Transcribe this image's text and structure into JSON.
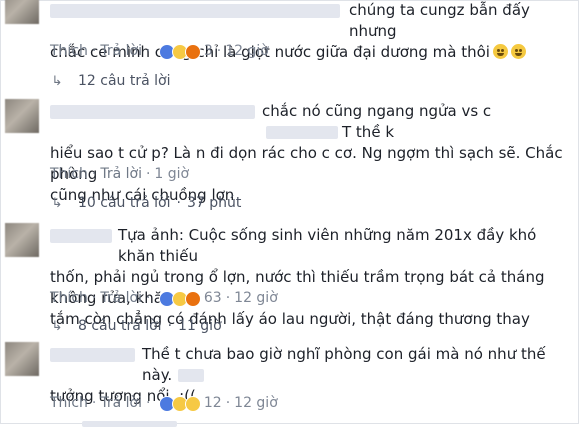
{
  "comments": [
    {
      "lines": [
        "chúng ta cungz bẫn đấy nhưng",
        "chắc ce mình cũng chỉ là giọt nước giữa đại dương mà thôi"
      ],
      "emoji": [
        "grinning-sweat",
        "grinning-sweat"
      ],
      "actions": {
        "like": "Thích",
        "reply": "Trả lời",
        "reaction_count": "3",
        "time": "12 giờ"
      },
      "reactions": [
        "like",
        "haha",
        "angry"
      ],
      "replies": "12 câu trả lời"
    },
    {
      "lines": [
        "chắc nó cũng ngang ngửa vs c",
        "T thề k",
        "hiểu sao t cử p? Là n đi dọn rác cho c cơ. Ng ngợm thì sạch sẽ. Chắc phòng",
        "cũng như cái chuồng lợn"
      ],
      "actions": {
        "like": "Thích",
        "reply": "Trả lời",
        "time": "1 giờ"
      },
      "replies": "10 câu trả lời",
      "replies_time": "37 phút"
    },
    {
      "lines": [
        "Tựa ảnh: Cuộc sống sinh viên những năm 201x đầy khó khăn thiếu",
        "thốn, phải ngủ trong ổ lợn, nước thì thiếu trầm trọng bát cả tháng không rửa, khăn",
        "tắm còn chẳng có đánh lấy áo lau người, thật đáng thương thay"
      ],
      "actions": {
        "like": "Thích",
        "reply": "Trả lời",
        "reaction_count": "63",
        "time": "12 giờ"
      },
      "reactions": [
        "like",
        "haha",
        "angry"
      ],
      "replies": "8 câu trả lời",
      "replies_time": "11 giờ"
    },
    {
      "lines": [
        "Thề t chưa bao giờ nghĩ phòng con gái mà nó như thế này.",
        "tưởng tượng nổi. :(("
      ],
      "actions": {
        "like": "Thích",
        "reply": "Trả lời",
        "reaction_count": "12",
        "time": "12 giờ"
      },
      "reactions": [
        "like",
        "haha",
        "sad"
      ]
    }
  ],
  "colors": {
    "text": "#1d2129",
    "meta": "#7f8795",
    "like": "#4c7ae0",
    "reaction_yellow": "#f6c944",
    "blur": "#e3e6ee"
  },
  "icons": {
    "reply_arrow": "reply-arrow-icon",
    "avatar": "blurred-avatar"
  }
}
